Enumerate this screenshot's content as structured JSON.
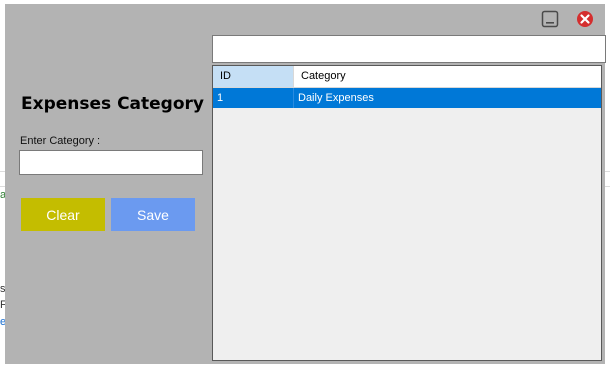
{
  "window": {
    "minimize_icon": "minimize-icon",
    "close_icon": "close-circle-icon",
    "close_color": "#d42e2e"
  },
  "form": {
    "title": "Expenses Category",
    "category_label": "Enter Category :",
    "category_value": "",
    "clear_label": "Clear",
    "save_label": "Save",
    "clear_color": "#c4bd00",
    "save_color": "#6b9af0"
  },
  "search": {
    "value": ""
  },
  "grid": {
    "columns": [
      "ID",
      "Category"
    ],
    "rows": [
      {
        "id": "1",
        "category": "Daily Expenses",
        "selected": true
      }
    ],
    "selected_color": "#0078d7"
  },
  "background_fragments": {
    "frag1": "a",
    "frag2": "s",
    "frag3": "F",
    "frag4": "e"
  }
}
